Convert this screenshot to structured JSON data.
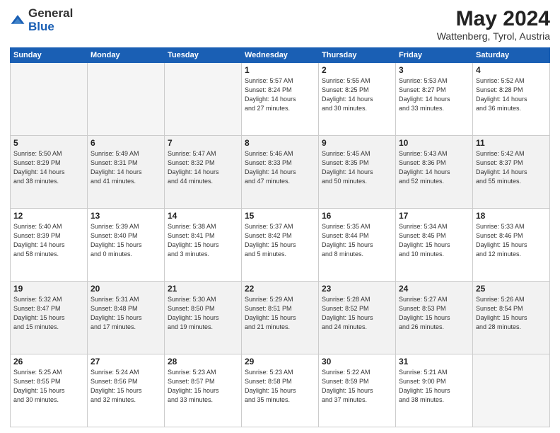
{
  "logo": {
    "general": "General",
    "blue": "Blue"
  },
  "header": {
    "month_year": "May 2024",
    "location": "Wattenberg, Tyrol, Austria"
  },
  "weekdays": [
    "Sunday",
    "Monday",
    "Tuesday",
    "Wednesday",
    "Thursday",
    "Friday",
    "Saturday"
  ],
  "weeks": [
    [
      {
        "num": "",
        "info": ""
      },
      {
        "num": "",
        "info": ""
      },
      {
        "num": "",
        "info": ""
      },
      {
        "num": "1",
        "info": "Sunrise: 5:57 AM\nSunset: 8:24 PM\nDaylight: 14 hours\nand 27 minutes."
      },
      {
        "num": "2",
        "info": "Sunrise: 5:55 AM\nSunset: 8:25 PM\nDaylight: 14 hours\nand 30 minutes."
      },
      {
        "num": "3",
        "info": "Sunrise: 5:53 AM\nSunset: 8:27 PM\nDaylight: 14 hours\nand 33 minutes."
      },
      {
        "num": "4",
        "info": "Sunrise: 5:52 AM\nSunset: 8:28 PM\nDaylight: 14 hours\nand 36 minutes."
      }
    ],
    [
      {
        "num": "5",
        "info": "Sunrise: 5:50 AM\nSunset: 8:29 PM\nDaylight: 14 hours\nand 38 minutes."
      },
      {
        "num": "6",
        "info": "Sunrise: 5:49 AM\nSunset: 8:31 PM\nDaylight: 14 hours\nand 41 minutes."
      },
      {
        "num": "7",
        "info": "Sunrise: 5:47 AM\nSunset: 8:32 PM\nDaylight: 14 hours\nand 44 minutes."
      },
      {
        "num": "8",
        "info": "Sunrise: 5:46 AM\nSunset: 8:33 PM\nDaylight: 14 hours\nand 47 minutes."
      },
      {
        "num": "9",
        "info": "Sunrise: 5:45 AM\nSunset: 8:35 PM\nDaylight: 14 hours\nand 50 minutes."
      },
      {
        "num": "10",
        "info": "Sunrise: 5:43 AM\nSunset: 8:36 PM\nDaylight: 14 hours\nand 52 minutes."
      },
      {
        "num": "11",
        "info": "Sunrise: 5:42 AM\nSunset: 8:37 PM\nDaylight: 14 hours\nand 55 minutes."
      }
    ],
    [
      {
        "num": "12",
        "info": "Sunrise: 5:40 AM\nSunset: 8:39 PM\nDaylight: 14 hours\nand 58 minutes."
      },
      {
        "num": "13",
        "info": "Sunrise: 5:39 AM\nSunset: 8:40 PM\nDaylight: 15 hours\nand 0 minutes."
      },
      {
        "num": "14",
        "info": "Sunrise: 5:38 AM\nSunset: 8:41 PM\nDaylight: 15 hours\nand 3 minutes."
      },
      {
        "num": "15",
        "info": "Sunrise: 5:37 AM\nSunset: 8:42 PM\nDaylight: 15 hours\nand 5 minutes."
      },
      {
        "num": "16",
        "info": "Sunrise: 5:35 AM\nSunset: 8:44 PM\nDaylight: 15 hours\nand 8 minutes."
      },
      {
        "num": "17",
        "info": "Sunrise: 5:34 AM\nSunset: 8:45 PM\nDaylight: 15 hours\nand 10 minutes."
      },
      {
        "num": "18",
        "info": "Sunrise: 5:33 AM\nSunset: 8:46 PM\nDaylight: 15 hours\nand 12 minutes."
      }
    ],
    [
      {
        "num": "19",
        "info": "Sunrise: 5:32 AM\nSunset: 8:47 PM\nDaylight: 15 hours\nand 15 minutes."
      },
      {
        "num": "20",
        "info": "Sunrise: 5:31 AM\nSunset: 8:48 PM\nDaylight: 15 hours\nand 17 minutes."
      },
      {
        "num": "21",
        "info": "Sunrise: 5:30 AM\nSunset: 8:50 PM\nDaylight: 15 hours\nand 19 minutes."
      },
      {
        "num": "22",
        "info": "Sunrise: 5:29 AM\nSunset: 8:51 PM\nDaylight: 15 hours\nand 21 minutes."
      },
      {
        "num": "23",
        "info": "Sunrise: 5:28 AM\nSunset: 8:52 PM\nDaylight: 15 hours\nand 24 minutes."
      },
      {
        "num": "24",
        "info": "Sunrise: 5:27 AM\nSunset: 8:53 PM\nDaylight: 15 hours\nand 26 minutes."
      },
      {
        "num": "25",
        "info": "Sunrise: 5:26 AM\nSunset: 8:54 PM\nDaylight: 15 hours\nand 28 minutes."
      }
    ],
    [
      {
        "num": "26",
        "info": "Sunrise: 5:25 AM\nSunset: 8:55 PM\nDaylight: 15 hours\nand 30 minutes."
      },
      {
        "num": "27",
        "info": "Sunrise: 5:24 AM\nSunset: 8:56 PM\nDaylight: 15 hours\nand 32 minutes."
      },
      {
        "num": "28",
        "info": "Sunrise: 5:23 AM\nSunset: 8:57 PM\nDaylight: 15 hours\nand 33 minutes."
      },
      {
        "num": "29",
        "info": "Sunrise: 5:23 AM\nSunset: 8:58 PM\nDaylight: 15 hours\nand 35 minutes."
      },
      {
        "num": "30",
        "info": "Sunrise: 5:22 AM\nSunset: 8:59 PM\nDaylight: 15 hours\nand 37 minutes."
      },
      {
        "num": "31",
        "info": "Sunrise: 5:21 AM\nSunset: 9:00 PM\nDaylight: 15 hours\nand 38 minutes."
      },
      {
        "num": "",
        "info": ""
      }
    ]
  ],
  "shading": [
    "white",
    "shaded",
    "white",
    "shaded",
    "white"
  ]
}
